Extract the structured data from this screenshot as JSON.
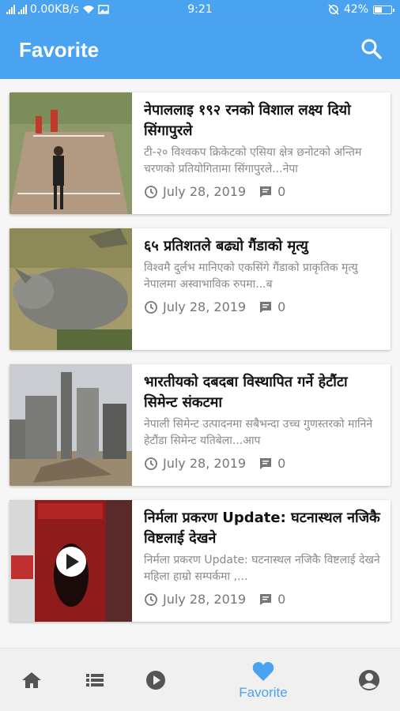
{
  "status_bar": {
    "network_speed": "0.00KB/s",
    "time": "9:21",
    "battery": "42%"
  },
  "app_bar": {
    "title": "Favorite"
  },
  "articles": [
    {
      "title": "नेपाललाइ १९२ रनको विशाल लक्ष्य दियो सिंगापुरले",
      "summary": "टी-२० विश्वकप क्रिकेटको एसिया क्षेत्र छनोटको अन्तिम चरणको प्रतियोगितामा सिंगापुरले...नेपा",
      "date": "July 28, 2019",
      "comments": "0",
      "thumbnail": "cricket-field-photo"
    },
    {
      "title": "६५ प्रतिशतले बढ्यो गैंडाको मृत्यु",
      "summary": "विश्वमै दुर्लभ मानिएको एकसिंगे गैंडाको प्राकृतिक मृत्यु नेपालमा अस्वाभाविक रुपमा...ब",
      "date": "July 28, 2019",
      "comments": "0",
      "thumbnail": "rhino-photo"
    },
    {
      "title": "भारतीयको दबदबा विस्थापित गर्ने हेटौंटा सिमेन्ट संकटमा",
      "summary": "नेपाली सिमेन्ट उत्पादनमा सबैभन्दा उच्च गुणस्तरको मानिने हेटौंडा सिमेन्ट यतिबेला...आप",
      "date": "July 28, 2019",
      "comments": "0",
      "thumbnail": "cement-factory-photo"
    },
    {
      "title": "निर्मला प्रकरण Update: घटनास्थल नजिकै विष्टलाई देखने",
      "summary": "निर्मला प्रकरण Update: घटनास्थल नजिकै विष्टलाई देखने महिला हाम्रो सम्पर्कमा ,...",
      "date": "July 28, 2019",
      "comments": "0",
      "thumbnail": "video-thumbnail"
    }
  ],
  "bottom_nav": {
    "items": [
      {
        "icon": "home-icon",
        "label": ""
      },
      {
        "icon": "list-icon",
        "label": ""
      },
      {
        "icon": "play-icon",
        "label": ""
      },
      {
        "icon": "heart-icon",
        "label": "Favorite",
        "active": true
      },
      {
        "icon": "account-icon",
        "label": ""
      }
    ]
  },
  "colors": {
    "primary": "#4aa3f0",
    "text_dark": "#111111",
    "text_muted": "#8a8a8a",
    "nav_inactive": "#555555"
  }
}
